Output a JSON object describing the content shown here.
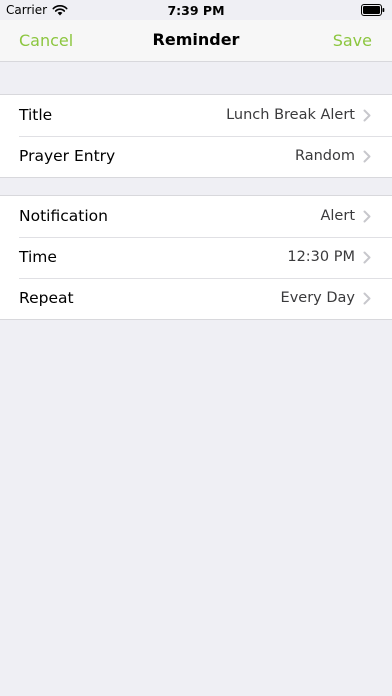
{
  "status_bar": {
    "carrier": "Carrier",
    "time": "7:39 PM",
    "wifi_icon": "wifi-icon",
    "battery_icon": "battery-full-icon"
  },
  "nav": {
    "cancel_label": "Cancel",
    "title": "Reminder",
    "save_label": "Save",
    "accent_color": "#8cc63f"
  },
  "sections": [
    {
      "rows": [
        {
          "label": "Title",
          "value": "Lunch Break Alert"
        },
        {
          "label": "Prayer Entry",
          "value": "Random"
        }
      ]
    },
    {
      "rows": [
        {
          "label": "Notification",
          "value": "Alert"
        },
        {
          "label": "Time",
          "value": "12:30 PM"
        },
        {
          "label": "Repeat",
          "value": "Every Day"
        }
      ]
    }
  ],
  "row_accessory_icon": "chevron-right-icon"
}
